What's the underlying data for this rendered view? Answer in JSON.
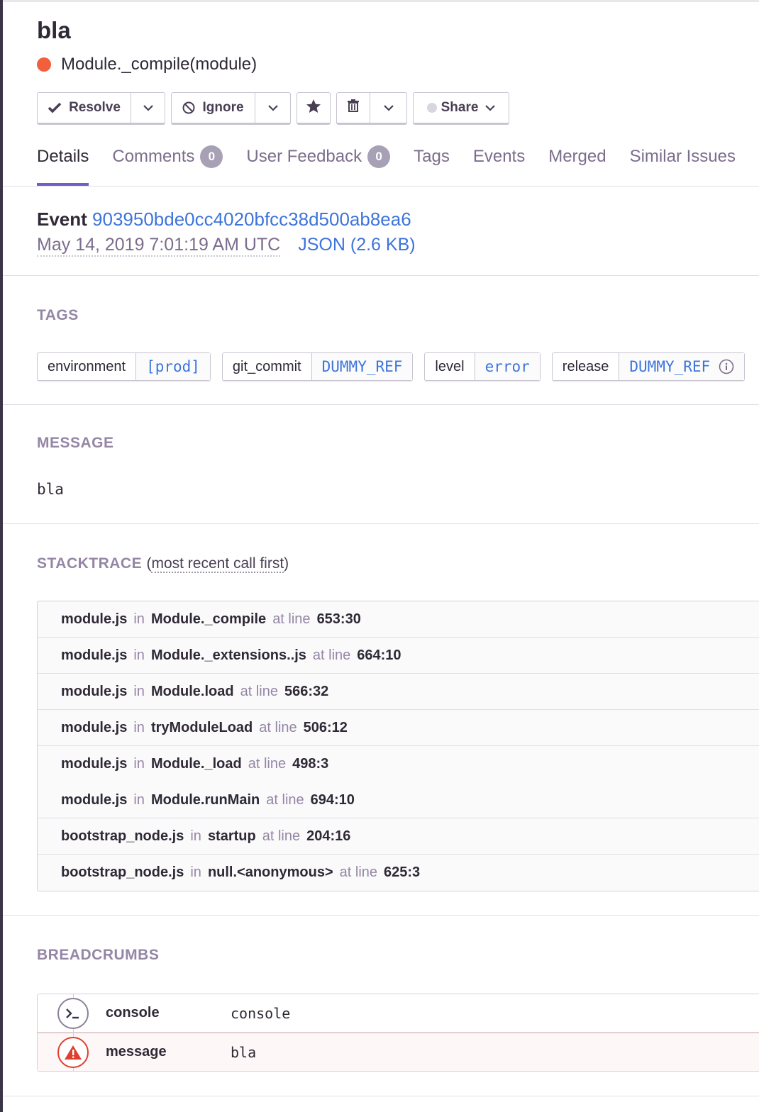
{
  "issue": {
    "title": "bla",
    "culprit": "Module._compile(module)",
    "level_color": "#f25f3d"
  },
  "actions": {
    "resolve_label": "Resolve",
    "ignore_label": "Ignore",
    "share_label": "Share"
  },
  "tabs": [
    {
      "label": "Details",
      "active": true
    },
    {
      "label": "Comments",
      "count": "0"
    },
    {
      "label": "User Feedback",
      "count": "0"
    },
    {
      "label": "Tags"
    },
    {
      "label": "Events"
    },
    {
      "label": "Merged"
    },
    {
      "label": "Similar Issues"
    }
  ],
  "event": {
    "label": "Event",
    "id": "903950bde0cc4020bfcc38d500ab8ea6",
    "date": "May 14, 2019 7:01:19 AM UTC",
    "json_label": "JSON (2.6 KB)"
  },
  "tags_section": {
    "title": "TAGS",
    "tags": [
      {
        "key": "environment",
        "value": "[prod]"
      },
      {
        "key": "git_commit",
        "value": "DUMMY_REF"
      },
      {
        "key": "level",
        "value": "error"
      },
      {
        "key": "release",
        "value": "DUMMY_REF"
      }
    ]
  },
  "message_section": {
    "title": "MESSAGE",
    "text": "bla"
  },
  "stacktrace": {
    "title": "STACKTRACE",
    "order_label": "most recent call first",
    "in_word": "in",
    "at_line_word": "at line",
    "frames": [
      {
        "file": "module.js",
        "func": "Module._compile",
        "line": "653:30"
      },
      {
        "file": "module.js",
        "func": "Module._extensions..js",
        "line": "664:10"
      },
      {
        "file": "module.js",
        "func": "Module.load",
        "line": "566:32"
      },
      {
        "file": "module.js",
        "func": "tryModuleLoad",
        "line": "506:12"
      },
      {
        "file": "module.js",
        "func": "Module._load",
        "line": "498:3"
      },
      {
        "file": "module.js",
        "func": "Module.runMain",
        "line": "694:10"
      },
      {
        "file": "bootstrap_node.js",
        "func": "startup",
        "line": "204:16"
      },
      {
        "file": "bootstrap_node.js",
        "func": "null.<anonymous>",
        "line": "625:3"
      }
    ]
  },
  "breadcrumbs": {
    "title": "BREADCRUMBS",
    "items": [
      {
        "type": "console",
        "message": "console",
        "icon": "terminal-icon"
      },
      {
        "type": "message",
        "message": "bla",
        "icon": "warning-icon"
      }
    ]
  },
  "colors": {
    "accent": "#6c5fc7",
    "link": "#3d74db",
    "error": "#e03e2f"
  }
}
